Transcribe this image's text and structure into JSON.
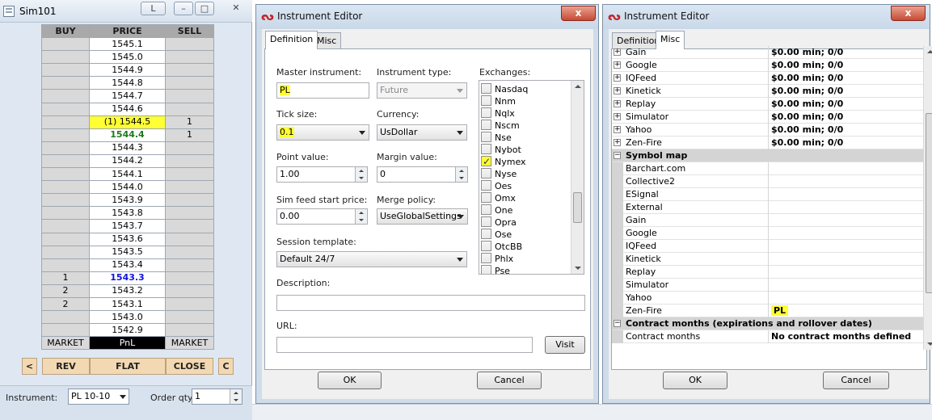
{
  "sim": {
    "title": "Sim101",
    "link_button": "L",
    "headers": [
      "BUY",
      "PRICE",
      "SELL"
    ],
    "rows": [
      {
        "buy": "",
        "price": "1545.1",
        "sell": ""
      },
      {
        "buy": "",
        "price": "1545.0",
        "sell": ""
      },
      {
        "buy": "",
        "price": "1544.9",
        "sell": ""
      },
      {
        "buy": "",
        "price": "1544.8",
        "sell": ""
      },
      {
        "buy": "",
        "price": "1544.7",
        "sell": ""
      },
      {
        "buy": "",
        "price": "1544.6",
        "sell": ""
      },
      {
        "buy": "",
        "price": "(1) 1544.5",
        "sell": "1"
      },
      {
        "buy": "",
        "price": "1544.4",
        "sell": "1"
      },
      {
        "buy": "",
        "price": "1544.3",
        "sell": ""
      },
      {
        "buy": "",
        "price": "1544.2",
        "sell": ""
      },
      {
        "buy": "",
        "price": "1544.1",
        "sell": ""
      },
      {
        "buy": "",
        "price": "1544.0",
        "sell": ""
      },
      {
        "buy": "",
        "price": "1543.9",
        "sell": ""
      },
      {
        "buy": "",
        "price": "1543.8",
        "sell": ""
      },
      {
        "buy": "",
        "price": "1543.7",
        "sell": ""
      },
      {
        "buy": "",
        "price": "1543.6",
        "sell": ""
      },
      {
        "buy": "",
        "price": "1543.5",
        "sell": ""
      },
      {
        "buy": "",
        "price": "1543.4",
        "sell": ""
      },
      {
        "buy": "1",
        "price": "1543.3",
        "sell": ""
      },
      {
        "buy": "2",
        "price": "1543.2",
        "sell": ""
      },
      {
        "buy": "2",
        "price": "1543.1",
        "sell": ""
      },
      {
        "buy": "",
        "price": "1543.0",
        "sell": ""
      },
      {
        "buy": "",
        "price": "1542.9",
        "sell": ""
      }
    ],
    "footer": [
      "MARKET",
      "PnL",
      "MARKET"
    ],
    "buttons": {
      "left": "<",
      "rev": "REV",
      "flat": "FLAT",
      "close": "CLOSE",
      "c": "C"
    },
    "instrument_label": "Instrument:",
    "instrument_value": "PL 10-10",
    "order_qty_label": "Order qty:",
    "order_qty_value": "1"
  },
  "editor1": {
    "title": "Instrument Editor",
    "close": "x",
    "tabs": [
      "Definition",
      "Misc"
    ],
    "master_label": "Master instrument:",
    "master_value": "PL",
    "type_label": "Instrument type:",
    "type_value": "Future",
    "tick_label": "Tick size:",
    "tick_value": "0.1",
    "currency_label": "Currency:",
    "currency_value": "UsDollar",
    "point_label": "Point value:",
    "point_value": "1.00",
    "margin_label": "Margin value:",
    "margin_value": "0",
    "simfeed_label": "Sim feed start price:",
    "simfeed_value": "0.00",
    "merge_label": "Merge policy:",
    "merge_value": "UseGlobalSettings",
    "session_label": "Session template:",
    "session_value": "Default 24/7",
    "description_label": "Description:",
    "url_label": "URL:",
    "visit": "Visit",
    "exchanges_label": "Exchanges:",
    "exchanges": [
      {
        "name": "Nasdaq",
        "checked": false
      },
      {
        "name": "Nnm",
        "checked": false
      },
      {
        "name": "Nqlx",
        "checked": false
      },
      {
        "name": "Nscm",
        "checked": false
      },
      {
        "name": "Nse",
        "checked": false
      },
      {
        "name": "Nybot",
        "checked": false
      },
      {
        "name": "Nymex",
        "checked": true
      },
      {
        "name": "Nyse",
        "checked": false
      },
      {
        "name": "Oes",
        "checked": false
      },
      {
        "name": "Omx",
        "checked": false
      },
      {
        "name": "One",
        "checked": false
      },
      {
        "name": "Opra",
        "checked": false
      },
      {
        "name": "Ose",
        "checked": false
      },
      {
        "name": "OtcBB",
        "checked": false
      },
      {
        "name": "Phlx",
        "checked": false
      },
      {
        "name": "Pse",
        "checked": false
      }
    ],
    "ok": "OK",
    "cancel": "Cancel"
  },
  "editor2": {
    "title": "Instrument Editor",
    "close": "x",
    "tabs": [
      "Definition",
      "Misc"
    ],
    "rows": [
      {
        "kind": "exp",
        "name": "Gain",
        "value": "$0.00 min;  0/0"
      },
      {
        "kind": "exp",
        "name": "Google",
        "value": "$0.00 min;  0/0"
      },
      {
        "kind": "exp",
        "name": "IQFeed",
        "value": "$0.00 min;  0/0"
      },
      {
        "kind": "exp",
        "name": "Kinetick",
        "value": "$0.00 min;  0/0"
      },
      {
        "kind": "exp",
        "name": "Replay",
        "value": "$0.00 min;  0/0"
      },
      {
        "kind": "exp",
        "name": "Simulator",
        "value": "$0.00 min;  0/0"
      },
      {
        "kind": "exp",
        "name": "Yahoo",
        "value": "$0.00 min;  0/0"
      },
      {
        "kind": "exp",
        "name": "Zen-Fire",
        "value": "$0.00 min;  0/0"
      },
      {
        "kind": "cat",
        "name": "Symbol map",
        "value": ""
      },
      {
        "kind": "item",
        "name": "Barchart.com",
        "value": ""
      },
      {
        "kind": "item",
        "name": "Collective2",
        "value": ""
      },
      {
        "kind": "item",
        "name": "ESignal",
        "value": ""
      },
      {
        "kind": "item",
        "name": "External",
        "value": ""
      },
      {
        "kind": "item",
        "name": "Gain",
        "value": ""
      },
      {
        "kind": "item",
        "name": "Google",
        "value": ""
      },
      {
        "kind": "item",
        "name": "IQFeed",
        "value": ""
      },
      {
        "kind": "item",
        "name": "Kinetick",
        "value": ""
      },
      {
        "kind": "item",
        "name": "Replay",
        "value": ""
      },
      {
        "kind": "item",
        "name": "Simulator",
        "value": ""
      },
      {
        "kind": "item",
        "name": "Yahoo",
        "value": ""
      },
      {
        "kind": "item",
        "name": "Zen-Fire",
        "value": "PL"
      },
      {
        "kind": "cat",
        "name": "Contract months (expirations and rollover dates)",
        "value": ""
      },
      {
        "kind": "item",
        "name": "Contract months",
        "value": "No contract months defined"
      }
    ],
    "ok": "OK",
    "cancel": "Cancel"
  }
}
